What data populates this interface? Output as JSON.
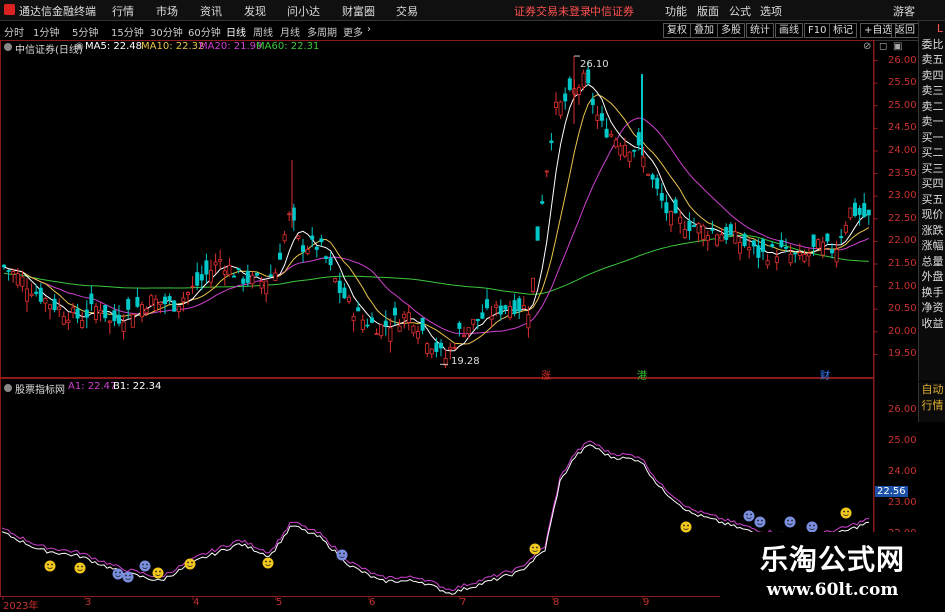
{
  "menubar": {
    "app_name": "通达信金融终端",
    "items": [
      "行情",
      "市场",
      "资讯",
      "发现",
      "问小达",
      "财富圈",
      "交易"
    ],
    "notice": "证券交易未登录",
    "broker": "中信证券",
    "right": [
      "功能",
      "版面",
      "公式",
      "选项"
    ],
    "user": "游客"
  },
  "periods": [
    "分时",
    "1分钟",
    "5分钟",
    "15分钟",
    "30分钟",
    "60分钟",
    "日线",
    "周线",
    "月线",
    "多周期",
    "更多"
  ],
  "active_period": "日线",
  "toolbar_right": [
    "复权",
    "叠加",
    "多股",
    "统计",
    "画线",
    "F10",
    "标记",
    "+自选",
    "返回"
  ],
  "main_header": {
    "stock": "中信证券(日线)",
    "ma": [
      {
        "label": "MA5: 22.48",
        "color": "#ffffff"
      },
      {
        "label": "MA10: 22.32",
        "color": "#e8c44a"
      },
      {
        "label": "MA20: 21.99",
        "color": "#d040d0"
      },
      {
        "label": "MA60: 22.31",
        "color": "#3cc83c"
      }
    ]
  },
  "sub_header": {
    "name": "股票指标网",
    "a1": "A1: 22.47",
    "b1": "B1: 22.34",
    "a1_color": "#d040d0",
    "b1_color": "#ffffff"
  },
  "main_axis": [
    "26.00",
    "25.50",
    "25.00",
    "24.50",
    "24.00",
    "23.50",
    "23.00",
    "22.50",
    "22.00",
    "21.50",
    "21.00",
    "20.50",
    "20.00",
    "19.50"
  ],
  "sub_axis": [
    "26.00",
    "25.00",
    "24.00",
    "23.00",
    "22.56",
    "22.00"
  ],
  "sub_axis_current": "22.56",
  "annotations": {
    "high": "26.10",
    "low": "19.28"
  },
  "markers": [
    {
      "label": "涨",
      "color": "#e03030"
    },
    {
      "label": "港",
      "color": "#30c030"
    },
    {
      "label": "财",
      "color": "#3080ff"
    }
  ],
  "x_axis": [
    "2023年",
    "3",
    "4",
    "5",
    "6",
    "7",
    "8",
    "9"
  ],
  "side_panel": [
    "L",
    "委比",
    "卖五",
    "卖四",
    "卖三",
    "卖二",
    "卖一",
    "买一",
    "买二",
    "买三",
    "买四",
    "买五",
    "现价",
    "涨跌",
    "涨幅",
    "总量",
    "外盘",
    "换手",
    "净资",
    "收益"
  ],
  "side_lower": [
    "自动",
    "行情"
  ],
  "watermark": {
    "title": "乐淘公式网",
    "url": "www.60lt.com"
  },
  "colors": {
    "up": "#e03030",
    "down": "#00c8c8",
    "ma5": "#ffffff",
    "ma10": "#e8c44a",
    "ma20": "#d040d0",
    "ma60": "#3cc83c"
  },
  "chart_data": [
    {
      "type": "candlestick",
      "title": "中信证券(日线)",
      "ylim": [
        19.0,
        26.3
      ],
      "series": [
        {
          "name": "MA5",
          "last": 22.48
        },
        {
          "name": "MA10",
          "last": 22.32
        },
        {
          "name": "MA20",
          "last": 21.99
        },
        {
          "name": "MA60",
          "last": 22.31
        }
      ],
      "high": 26.1,
      "low": 19.28
    },
    {
      "type": "line",
      "title": "股票指标网",
      "ylim": [
        20.0,
        26.6
      ],
      "series": [
        {
          "name": "A1",
          "last": 22.47
        },
        {
          "name": "B1",
          "last": 22.34
        }
      ]
    }
  ]
}
